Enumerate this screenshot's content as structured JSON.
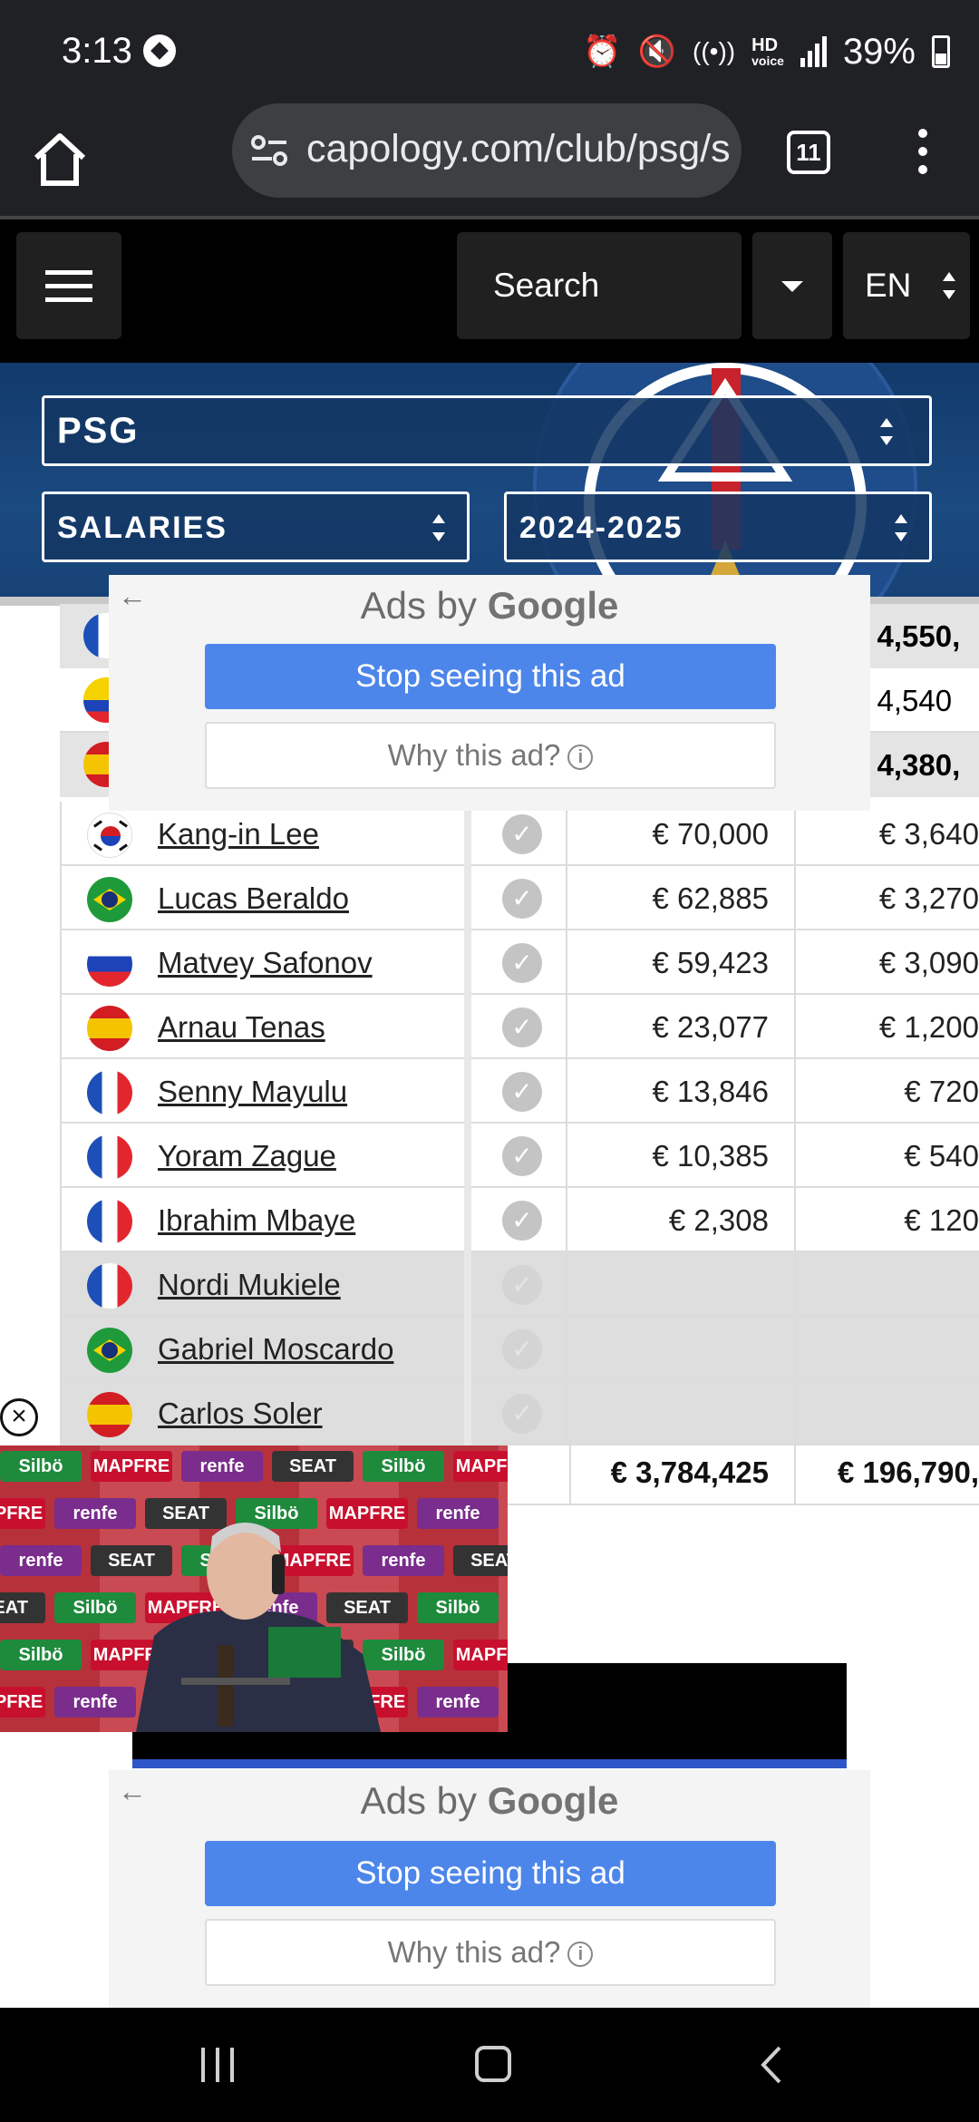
{
  "status_bar": {
    "time": "3:13",
    "battery": "39%",
    "hd_label": "HD",
    "voice_label": "voice"
  },
  "browser": {
    "url": "capology.com/club/psg/s",
    "tab_count": "11"
  },
  "site_header": {
    "search_label": "Search",
    "language": "EN"
  },
  "banner": {
    "club": "PSG",
    "view": "SALARIES",
    "season": "2024-2025"
  },
  "partial_rows": [
    {
      "weekly": "€ 4,550,",
      "bold": true,
      "flag": "fr"
    },
    {
      "weekly": "€ 4,540",
      "bold": false,
      "flag": "ec"
    },
    {
      "weekly": "€ 4,380,",
      "bold": true,
      "flag": "es"
    }
  ],
  "players": [
    {
      "name": "Kang-in Lee",
      "flag": "kr",
      "annual": "€ 70,000",
      "weekly": "€ 3,640",
      "active": true
    },
    {
      "name": "Lucas Beraldo",
      "flag": "br",
      "annual": "€ 62,885",
      "weekly": "€ 3,270",
      "active": true
    },
    {
      "name": "Matvey Safonov",
      "flag": "ru",
      "annual": "€ 59,423",
      "weekly": "€ 3,090",
      "active": true
    },
    {
      "name": "Arnau Tenas",
      "flag": "es",
      "annual": "€ 23,077",
      "weekly": "€ 1,200",
      "active": true
    },
    {
      "name": "Senny Mayulu",
      "flag": "fr",
      "annual": "€ 13,846",
      "weekly": "€ 720",
      "active": true
    },
    {
      "name": "Yoram Zague",
      "flag": "fr",
      "annual": "€ 10,385",
      "weekly": "€ 540",
      "active": true
    },
    {
      "name": "Ibrahim Mbaye",
      "flag": "fr",
      "annual": "€ 2,308",
      "weekly": "€ 120",
      "active": true
    },
    {
      "name": "Nordi Mukiele",
      "flag": "fr",
      "annual": "",
      "weekly": "",
      "active": false
    },
    {
      "name": "Gabriel Moscardo",
      "flag": "br",
      "annual": "",
      "weekly": "",
      "active": false
    },
    {
      "name": "Carlos Soler",
      "flag": "es",
      "annual": "",
      "weekly": "",
      "active": false
    }
  ],
  "totals": {
    "annual": "€ 3,784,425",
    "weekly": "€ 196,790,"
  },
  "ads": {
    "title_prefix": "Ads by",
    "title_brand": "Google",
    "stop_label": "Stop seeing this ad",
    "why_label": "Why this ad?"
  },
  "video": {
    "sponsors": [
      "Silbö",
      "MAPFRE",
      "renfe",
      "SEAT"
    ]
  },
  "icons": {
    "home": "home-icon",
    "site_settings": "tune-icon",
    "new_tab": "plus-icon",
    "menu": "more-vert-icon",
    "check": "check-icon",
    "close": "close-icon"
  },
  "colors": {
    "banner": "#1b4a80",
    "ad_button": "#4d86ea",
    "browser": "#202124"
  }
}
